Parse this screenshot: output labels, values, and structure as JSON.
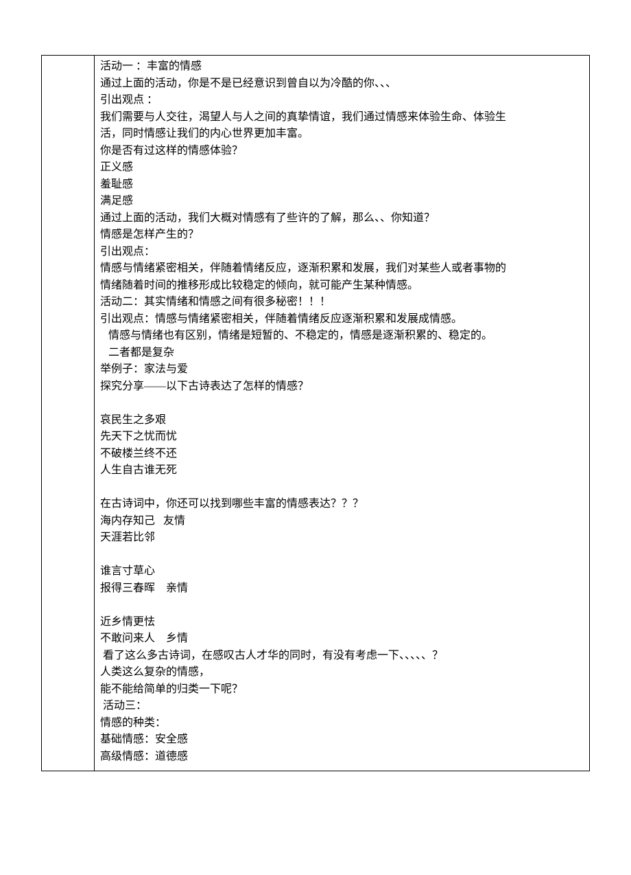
{
  "lines": [
    {
      "text": "活动一 ：丰富的情感"
    },
    {
      "text": "通过上面的活动，你是不是已经意识到曾自以为冷酷的你、、、"
    },
    {
      "text": "引出观点 ："
    },
    {
      "text": "我们需要与人交往，渴望人与人之间的真挚情谊，我们通过情感来体验生命、体验生"
    },
    {
      "text": "活，同时情感让我们的内心世界更加丰富。"
    },
    {
      "text": "你是否有过这样的情感体验？"
    },
    {
      "text": "正义感"
    },
    {
      "text": "羞耻感"
    },
    {
      "text": "满足感"
    },
    {
      "text": "通过上面的活动，我们大概对情感有了些许的了解，那么、、你知道？"
    },
    {
      "text": "情感是怎样产生的？"
    },
    {
      "text": "引出观点："
    },
    {
      "text": "情感与情绪紧密相关，伴随着情绪反应，逐渐积累和发展，我们对某些人或者事物的"
    },
    {
      "text": "情绪随着时间的推移形成比较稳定的倾向，就可能产生某种情感。"
    },
    {
      "text": "活动二：其实情绪和情感之间有很多秘密！！！"
    },
    {
      "text": "引出观点：情感与情绪紧密相关，伴随着情绪反应逐渐积累和发展成情感。"
    },
    {
      "text": "   情感与情绪也有区别，情绪是短暂的、不稳定的，情感是逐渐积累的、稳定的。"
    },
    {
      "text": "   二者都是复杂"
    },
    {
      "text": "举例子：家法与爱"
    },
    {
      "text": "探究分享——以下古诗表达了怎样的情感？"
    },
    {
      "text": ""
    },
    {
      "text": "哀民生之多艰"
    },
    {
      "text": "先天下之忧而忧"
    },
    {
      "text": "不破楼兰终不还"
    },
    {
      "text": "人生自古谁无死"
    },
    {
      "text": ""
    },
    {
      "text": "在古诗词中，你还可以找到哪些丰富的情感表达？？？"
    },
    {
      "text": "海内存知己   友情"
    },
    {
      "text": "天涯若比邻"
    },
    {
      "text": ""
    },
    {
      "text": "谁言寸草心"
    },
    {
      "text": "报得三春晖    亲情"
    },
    {
      "text": ""
    },
    {
      "text": "近乡情更怯"
    },
    {
      "text": "不敢问来人    乡情"
    },
    {
      "text": " 看了这么多古诗词，在感叹古人才华的同时，有没有考虑一下、、、、、？"
    },
    {
      "text": "人类这么复杂的情感，"
    },
    {
      "text": "能不能给简单的归类一下呢？"
    },
    {
      "text": " 活动三："
    },
    {
      "text": "情感的种类："
    },
    {
      "text": "基础情感：安全感"
    },
    {
      "text": "高级情感：道德感"
    }
  ]
}
